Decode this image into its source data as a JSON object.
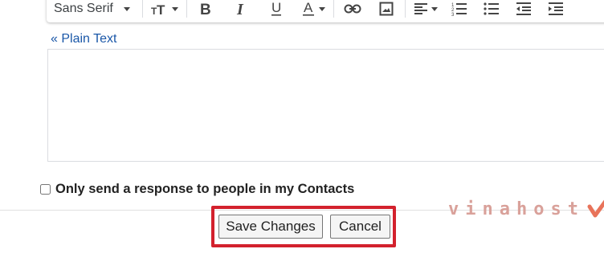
{
  "toolbar": {
    "font_family": "Sans Serif",
    "icons": [
      "font-size-icon",
      "bold-icon",
      "italic-icon",
      "underline-icon",
      "text-color-icon",
      "link-icon",
      "image-icon",
      "align-icon",
      "numbered-list-icon",
      "bulleted-list-icon",
      "indent-less-icon",
      "indent-more-icon"
    ]
  },
  "plain_text_link": "« Plain Text",
  "editor": {
    "value": ""
  },
  "contacts_option": {
    "label": "Only send a response to people in my Contacts",
    "checked": false
  },
  "actions": {
    "save_label": "Save Changes",
    "cancel_label": "Cancel"
  },
  "colors": {
    "highlight_border": "#d3212d",
    "link": "#1a57a8",
    "watermark": "#d9a19a"
  },
  "watermark": {
    "text": "vinahost"
  }
}
